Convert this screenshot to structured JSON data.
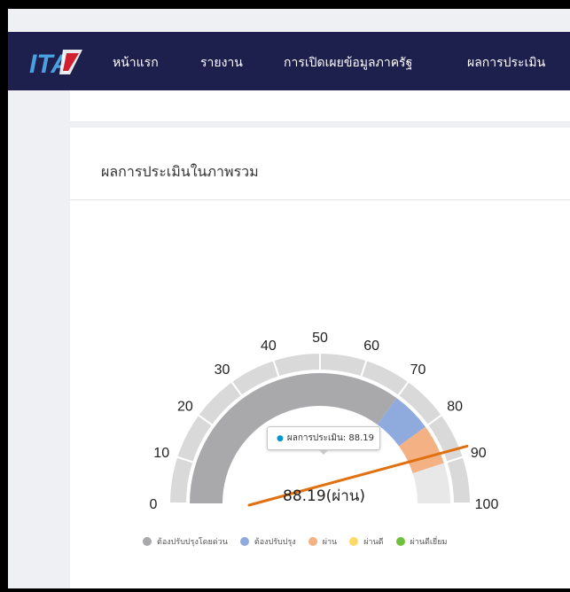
{
  "nav": {
    "logo_text": "ITA",
    "items": [
      {
        "label": "หน้าแรก"
      },
      {
        "label": "รายงาน"
      },
      {
        "label": "การเปิดเผยข้อมูลภาครัฐ"
      },
      {
        "label": "ผลการประเมิน"
      }
    ]
  },
  "card": {
    "title": "ผลการประเมินในภาพรวม"
  },
  "gauge": {
    "ticks": [
      "0",
      "10",
      "20",
      "30",
      "40",
      "50",
      "60",
      "70",
      "80",
      "90",
      "100"
    ],
    "value": 88.19,
    "score_text": "88.19(ผ่าน)",
    "tooltip_label": "ผลการประเมิน: 88.19",
    "band_colors": {
      "urgent": "#a9a8aa",
      "improve": "#8faadc",
      "pass": "#f4b183",
      "good": "#ffd966",
      "excellent": "#70c040"
    },
    "needle_color": "#e07010"
  },
  "legend": [
    {
      "label": "ต้องปรับปรุงโดยด่วน",
      "color": "#a9a8aa"
    },
    {
      "label": "ต้องปรับปรุง",
      "color": "#8faadc"
    },
    {
      "label": "ผ่าน",
      "color": "#f4b183"
    },
    {
      "label": "ผ่านดี",
      "color": "#ffd966"
    },
    {
      "label": "ผ่านดีเยี่ยม",
      "color": "#70c040"
    }
  ]
}
